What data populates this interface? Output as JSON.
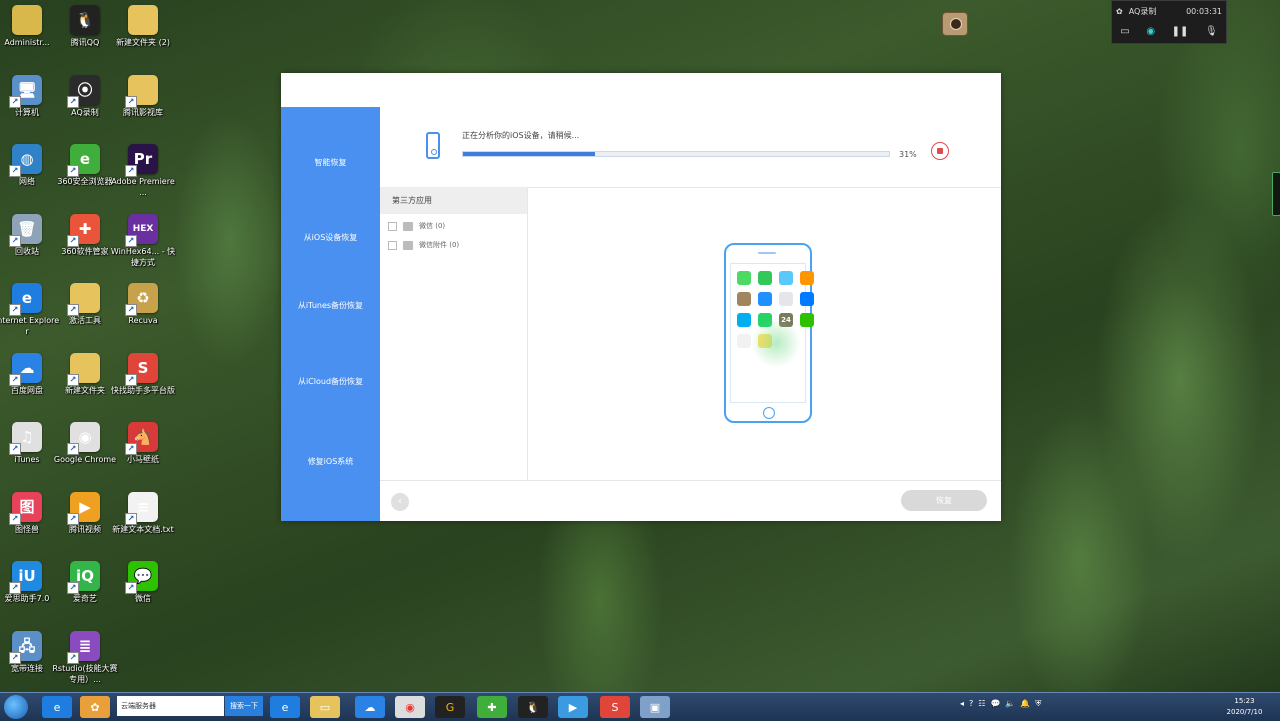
{
  "desktop_icons": [
    {
      "label": "Administr...",
      "icon": "folder-user-icon",
      "color": "#d8b84a",
      "glyph": ""
    },
    {
      "label": "腾讯QQ",
      "icon": "qq-penguin-icon",
      "color": "#222222",
      "glyph": "🐧"
    },
    {
      "label": "新建文件夹 (2)",
      "icon": "folder-icon",
      "color": "#e6c35c",
      "glyph": ""
    },
    {
      "label": "计算机",
      "icon": "computer-icon",
      "color": "#5a8fc8",
      "glyph": "🖥"
    },
    {
      "label": "AQ录制",
      "icon": "aq-recorder-icon",
      "color": "#2b2b2b",
      "glyph": "⦿"
    },
    {
      "label": "腾讯影视库",
      "icon": "folder-video-icon",
      "color": "#e6c35c",
      "glyph": ""
    },
    {
      "label": "网络",
      "icon": "network-globe-icon",
      "color": "#2f82c8",
      "glyph": "◍"
    },
    {
      "label": "360安全浏览器",
      "icon": "360-browser-icon",
      "color": "#3fae3a",
      "glyph": "e"
    },
    {
      "label": "Adobe Premiere ...",
      "icon": "premiere-icon",
      "color": "#2a1447",
      "glyph": "Pr"
    },
    {
      "label": "回收站",
      "icon": "recycle-bin-icon",
      "color": "#8fa3b8",
      "glyph": "🗑"
    },
    {
      "label": "360软件管家",
      "icon": "360-software-icon",
      "color": "#e9543b",
      "glyph": "✚"
    },
    {
      "label": "WinHex64... - 快捷方式",
      "icon": "winhex-icon",
      "color": "#6a2fa0",
      "glyph": "HEX"
    },
    {
      "label": "Internet Explorer",
      "icon": "ie-icon",
      "color": "#1f7de0",
      "glyph": "e"
    },
    {
      "label": "激活工具",
      "icon": "folder-tools-icon",
      "color": "#e6c35c",
      "glyph": ""
    },
    {
      "label": "Recuva",
      "icon": "recuva-icon",
      "color": "#c8a24a",
      "glyph": "♻"
    },
    {
      "label": "百度网盘",
      "icon": "baidu-netdisk-icon",
      "color": "#2a82e4",
      "glyph": "☁"
    },
    {
      "label": "新建文件夹",
      "icon": "folder-icon",
      "color": "#e6c35c",
      "glyph": ""
    },
    {
      "label": "快找助手多平台版",
      "icon": "kuaizhao-icon",
      "color": "#e0453a",
      "glyph": "S"
    },
    {
      "label": "iTunes",
      "icon": "itunes-icon",
      "color": "#e0e0e0",
      "glyph": "♫"
    },
    {
      "label": "Google Chrome",
      "icon": "chrome-icon",
      "color": "#e0e0e0",
      "glyph": "◉"
    },
    {
      "label": "小马壁纸",
      "icon": "pony-wallpaper-icon",
      "color": "#d83a3a",
      "glyph": "🐴"
    },
    {
      "label": "图怪兽",
      "icon": "tuguaishou-icon",
      "color": "#e8425a",
      "glyph": "图"
    },
    {
      "label": "腾讯视频",
      "icon": "tencent-video-icon",
      "color": "#f0a020",
      "glyph": "▶"
    },
    {
      "label": "新建文本文档.txt",
      "icon": "text-file-icon",
      "color": "#f2f2f2",
      "glyph": "≡"
    },
    {
      "label": "爱思助手7.0",
      "icon": "i4-assistant-icon",
      "color": "#1f8ae0",
      "glyph": "iU"
    },
    {
      "label": "爱奇艺",
      "icon": "iqiyi-icon",
      "color": "#33b54a",
      "glyph": "iQ"
    },
    {
      "label": "微信",
      "icon": "wechat-icon",
      "color": "#2dc100",
      "glyph": "💬"
    },
    {
      "label": "宽带连接",
      "icon": "broadband-icon",
      "color": "#5a8fc8",
      "glyph": "🖧"
    },
    {
      "label": "Rstudio(技能大赛专用）...",
      "icon": "rstudio-icon",
      "color": "#8a4ac0",
      "glyph": "≣"
    }
  ],
  "aq_widget": {
    "title": "AQ录制",
    "time": "00:03:31"
  },
  "app": {
    "sidebar": [
      {
        "label": "智能恢复"
      },
      {
        "label": "从iOS设备恢复"
      },
      {
        "label": "从iTunes备份恢复"
      },
      {
        "label": "从iCloud备份恢复"
      },
      {
        "label": "修复iOS系统"
      }
    ],
    "status_text": "正在分析你的iOS设备，请稍候...",
    "progress": 0.31,
    "progress_label": "31%",
    "list_header": "第三方应用",
    "list_items": [
      {
        "label": "微信 (0)"
      },
      {
        "label": "微信附件 (0)"
      }
    ],
    "restore_label": "恢复",
    "back_label": "‹",
    "phone_badge": "24"
  },
  "taskbar": {
    "search_text": "云端服务器",
    "search_button": "搜索一下",
    "clock_time": "15:23",
    "clock_date": "2020/7/10"
  },
  "colors": {
    "accent": "#4a90f0",
    "progress_fill": "#3d7fd9",
    "stop_red": "#e14b4b"
  }
}
